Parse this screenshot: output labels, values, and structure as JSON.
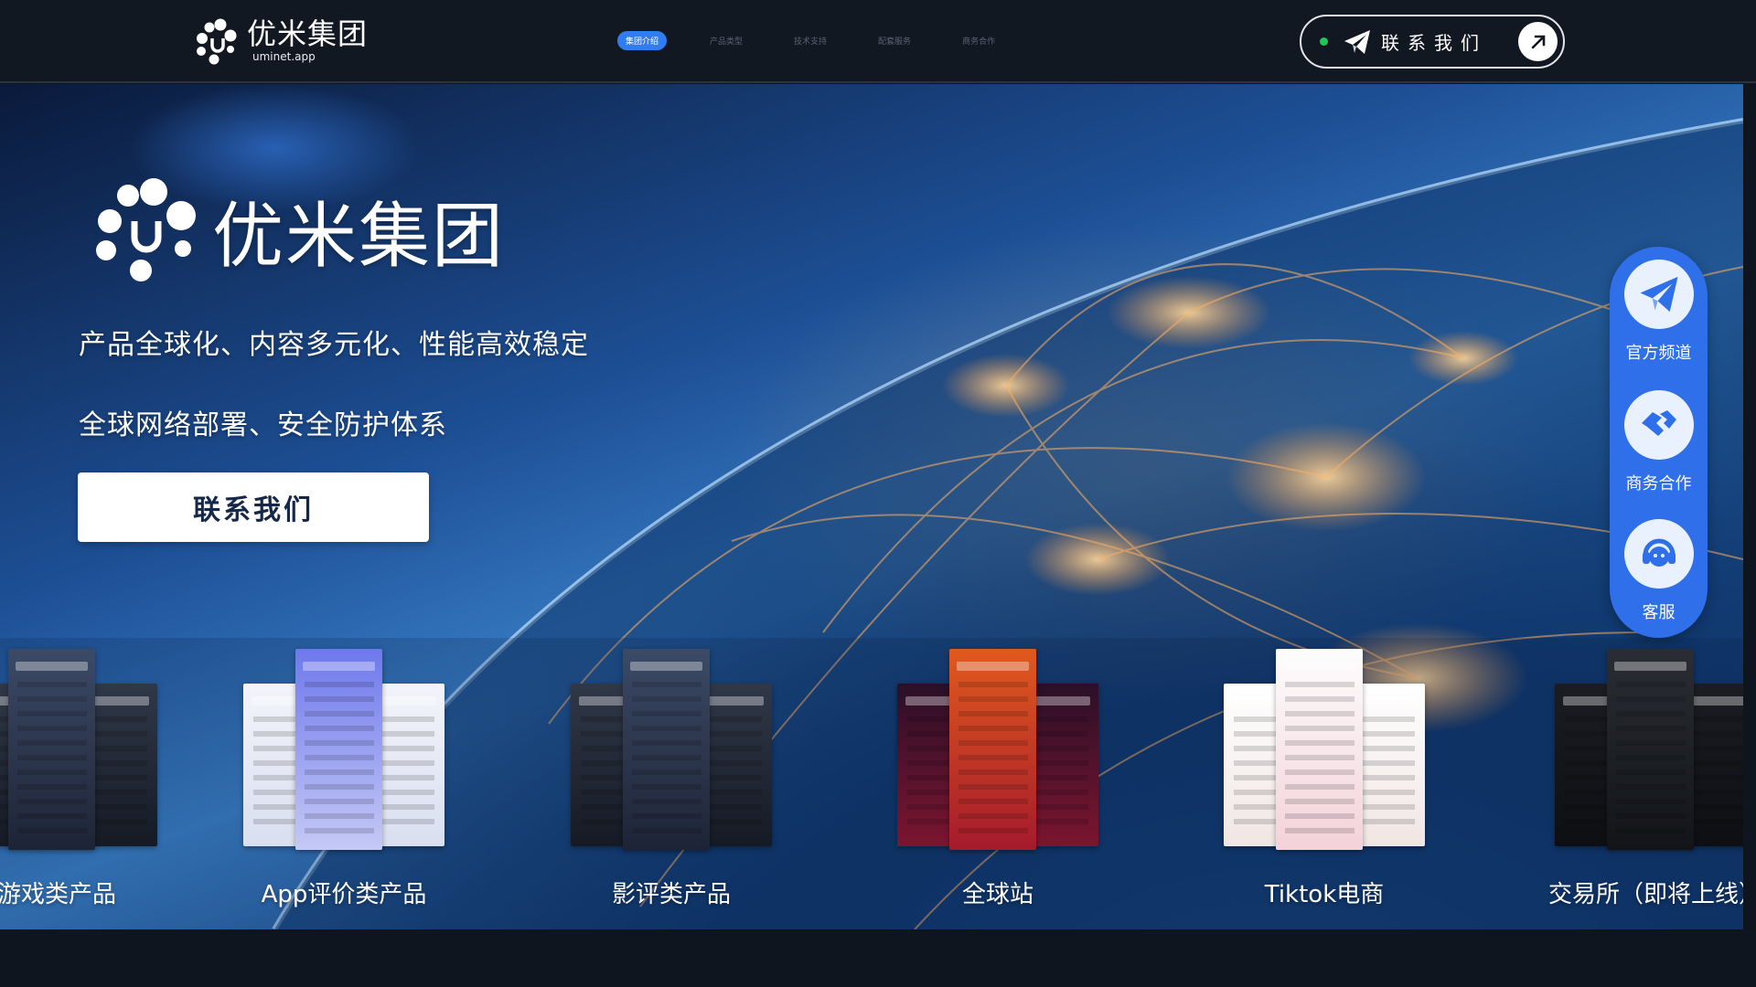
{
  "header": {
    "logo": {
      "name": "优米集团",
      "domain": "uminet.app",
      "icon": "umi-logo-icon"
    },
    "nav": [
      {
        "label": "集团介绍",
        "active": true
      },
      {
        "label": "产品类型",
        "active": false
      },
      {
        "label": "技术支持",
        "active": false
      },
      {
        "label": "配套服务",
        "active": false
      },
      {
        "label": "商务合作",
        "active": false
      }
    ],
    "contact_button": {
      "label": "联系我们",
      "icon": "telegram-plane-icon",
      "arrow_icon": "arrow-up-right-icon",
      "status": "online"
    }
  },
  "hero": {
    "logo_name": "优米集团",
    "tagline_1": "产品全球化、内容多元化、性能高效稳定",
    "tagline_2": "全球网络部署、安全防护体系",
    "cta_label": "联系我们"
  },
  "products": [
    {
      "label": "游戏类产品",
      "theme": "dark"
    },
    {
      "label": "App评价类产品",
      "theme": "light"
    },
    {
      "label": "影评类产品",
      "theme": "dark"
    },
    {
      "label": "全球站",
      "theme": "casino"
    },
    {
      "label": "Tiktok电商",
      "theme": "shop"
    },
    {
      "label": "交易所（即将上线）",
      "theme": "exchange"
    }
  ],
  "side_panel": [
    {
      "label": "官方频道",
      "icon": "telegram-icon"
    },
    {
      "label": "商务合作",
      "icon": "handshake-icon"
    },
    {
      "label": "客服",
      "icon": "customer-service-icon"
    }
  ],
  "colors": {
    "header_bg": "#121821",
    "accent": "#2f7df0",
    "side_panel": "#2f6fe9",
    "online_dot": "#20c656",
    "cta_text": "#152848"
  }
}
